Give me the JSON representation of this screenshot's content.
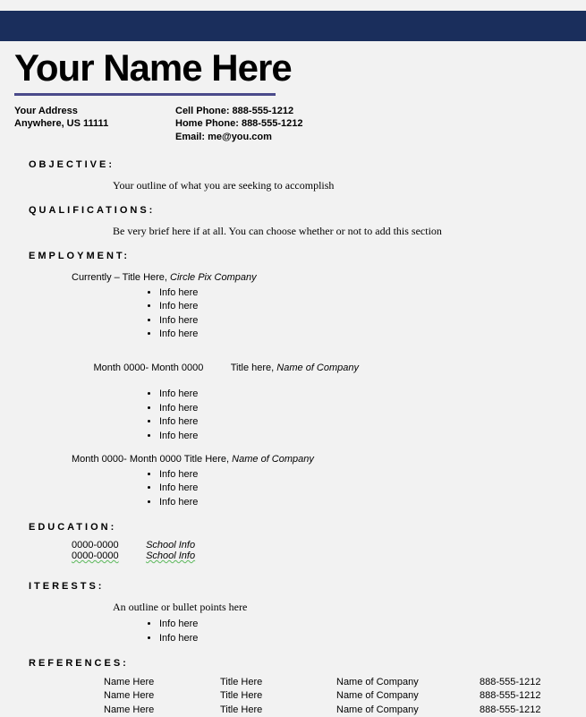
{
  "header": {
    "name": "Your Name Here",
    "address_line1": "Your Address",
    "address_line2": "Anywhere, US 11111",
    "cell_phone_label": "Cell Phone: 888-555-1212",
    "home_phone_label": "Home Phone: 888-555-1212",
    "email_label": "Email: me@you.com"
  },
  "objective": {
    "heading": "OBJECTIVE:",
    "text": "Your outline of what you are seeking to accomplish"
  },
  "qualifications": {
    "heading": "QUALIFICATIONS:",
    "text": "Be very brief here if at all. You can choose whether or not to add this section"
  },
  "employment": {
    "heading": "EMPLOYMENT:",
    "jobs": [
      {
        "line": "Currently – Title Here, ",
        "company": "Circle Pix Company",
        "bullets": [
          "Info here",
          "Info here",
          "Info here",
          "Info here"
        ]
      },
      {
        "line": "Month 0000- Month 0000          Title here, ",
        "company": "Name of Company",
        "bullets": [
          "Info here",
          "Info here",
          "Info here",
          "Info here"
        ]
      },
      {
        "line": "Month 0000- Month 0000  Title Here, ",
        "company": "Name of Company",
        "bullets": [
          "Info here",
          "Info here",
          "Info here"
        ]
      }
    ]
  },
  "education": {
    "heading": "EDUCATION:",
    "rows": [
      {
        "dates": "0000-0000",
        "school": "School Info"
      },
      {
        "dates": "0000-0000",
        "school": "School Info"
      }
    ]
  },
  "interests": {
    "heading": "ITERESTS:",
    "text": "An outline or bullet points here",
    "bullets": [
      "Info here",
      "Info here"
    ]
  },
  "references": {
    "heading": "REFERENCES:",
    "rows": [
      {
        "name": "Name Here",
        "title": "Title Here",
        "company": "Name of Company",
        "phone": "888-555-1212"
      },
      {
        "name": "Name Here",
        "title": "Title Here",
        "company": "Name of Company",
        "phone": "888-555-1212"
      },
      {
        "name": "Name Here",
        "title": "Title Here",
        "company": "Name of Company",
        "phone": "888-555-1212"
      }
    ]
  }
}
